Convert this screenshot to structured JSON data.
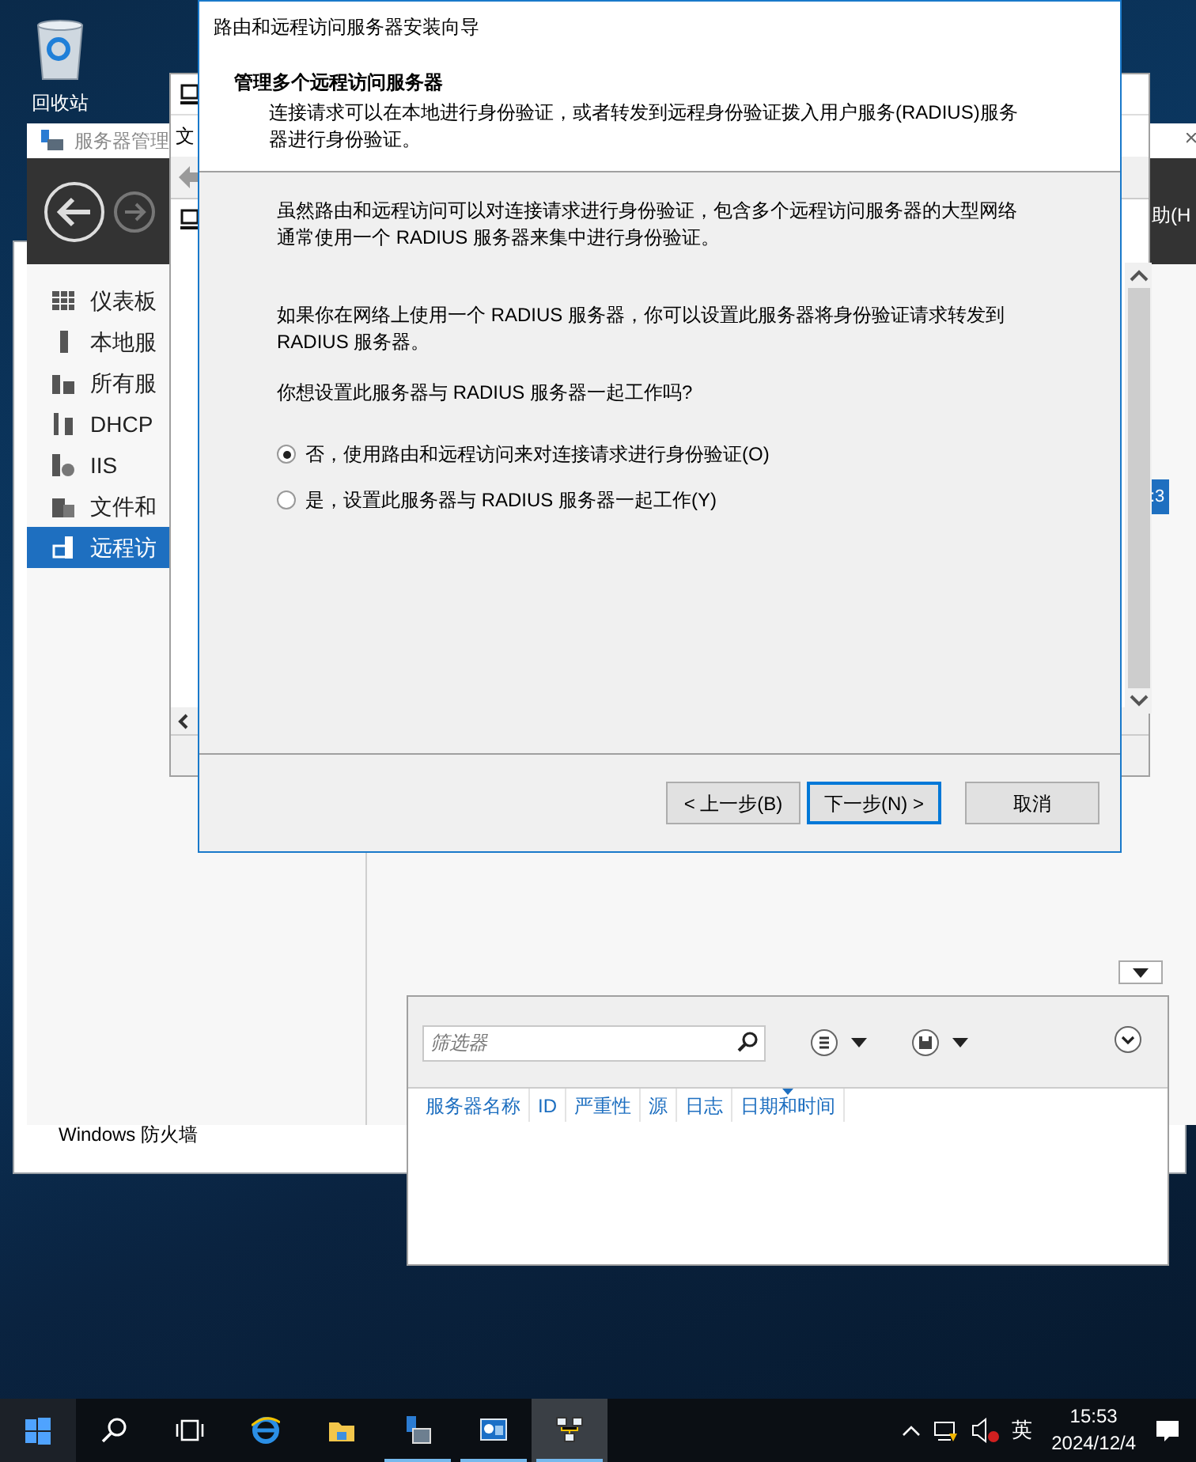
{
  "desktop": {
    "icons": [
      {
        "label": "回收站"
      }
    ]
  },
  "back_window": {
    "footer_text": "Windows 防火墙"
  },
  "mmc_window": {
    "menu_item": "文"
  },
  "server_manager": {
    "title": "服务器管理",
    "menu_item": "助(H",
    "selected_row_text": ":3",
    "nav": [
      {
        "label": "仪表板",
        "selected": false
      },
      {
        "label": "本地服",
        "selected": false
      },
      {
        "label": "所有服",
        "selected": false
      },
      {
        "label": "DHCP",
        "selected": false
      },
      {
        "label": "IIS",
        "selected": false
      },
      {
        "label": "文件和",
        "selected": false
      },
      {
        "label": "远程访",
        "selected": true
      }
    ],
    "events": {
      "filter": {
        "placeholder": "筛选器"
      },
      "columns": [
        {
          "label": "服务器名称",
          "sorted": false
        },
        {
          "label": "ID",
          "sorted": false
        },
        {
          "label": "严重性",
          "sorted": false
        },
        {
          "label": "源",
          "sorted": false
        },
        {
          "label": "日志",
          "sorted": false
        },
        {
          "label": "日期和时间",
          "sorted": true
        }
      ]
    }
  },
  "wizard": {
    "title": "路由和远程访问服务器安装向导",
    "heading": "管理多个远程访问服务器",
    "description": "连接请求可以在本地进行身份验证，或者转发到远程身份验证拨入用户服务(RADIUS)服务器进行身份验证。",
    "paragraphs": [
      "虽然路由和远程访问可以对连接请求进行身份验证，包含多个远程访问服务器的大型网络通常使用一个 RADIUS 服务器来集中进行身份验证。",
      "如果你在网络上使用一个 RADIUS 服务器，你可以设置此服务器将身份验证请求转发到 RADIUS 服务器。",
      "你想设置此服务器与 RADIUS 服务器一起工作吗?"
    ],
    "options": [
      {
        "label": "否，使用路由和远程访问来对连接请求进行身份验证(O)",
        "selected": true
      },
      {
        "label": "是，设置此服务器与 RADIUS 服务器一起工作(Y)",
        "selected": false
      }
    ],
    "buttons": [
      {
        "label": "< 上一步(B)",
        "focused": false
      },
      {
        "label": "下一步(N) >",
        "focused": true
      },
      {
        "label": "取消",
        "focused": false
      }
    ]
  },
  "taskbar": {
    "apps": [
      {
        "kind": "start",
        "running": false,
        "selected": false
      },
      {
        "kind": "search",
        "running": false,
        "selected": false
      },
      {
        "kind": "taskview",
        "running": false,
        "selected": false
      },
      {
        "kind": "browser",
        "running": false,
        "selected": false
      },
      {
        "kind": "folder",
        "running": false,
        "selected": false
      },
      {
        "kind": "servermanager",
        "running": true,
        "selected": false
      },
      {
        "kind": "dashboard",
        "running": true,
        "selected": false
      },
      {
        "kind": "network",
        "running": true,
        "selected": true
      }
    ],
    "tray": {
      "ime": "英",
      "time": "15:53",
      "date": "2024/12/4"
    }
  }
}
